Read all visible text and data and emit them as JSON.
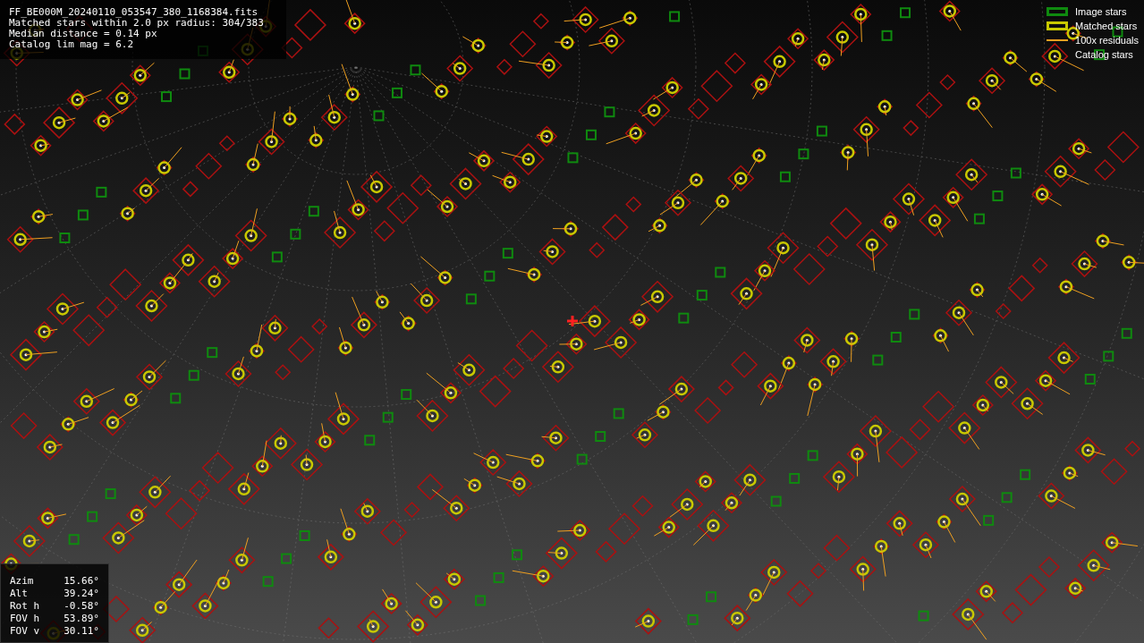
{
  "info_lines": [
    "FF_BE000M_20240110_053547_380_1168384.fits",
    "Matched stars within 2.0 px radius: 304/383",
    "Median distance = 0.14 px",
    "Catalog lim mag = 6.2"
  ],
  "legend": [
    {
      "kind": "box",
      "color": "#0f8a0f",
      "label": "Image stars"
    },
    {
      "kind": "box",
      "color": "#c8c800",
      "label": "Matched stars"
    },
    {
      "kind": "line",
      "color": "#f0a020",
      "label": "100x residuals"
    },
    {
      "kind": "none",
      "label": "Catalog stars"
    }
  ],
  "pointing": [
    {
      "label": "Azim",
      "value": "15.66°"
    },
    {
      "label": "Alt",
      "value": "39.24°"
    },
    {
      "label": "Rot h",
      "value": "-0.58°"
    },
    {
      "label": "FOV h",
      "value": "53.89°"
    },
    {
      "label": "FOV v",
      "value": "30.11°"
    }
  ]
}
